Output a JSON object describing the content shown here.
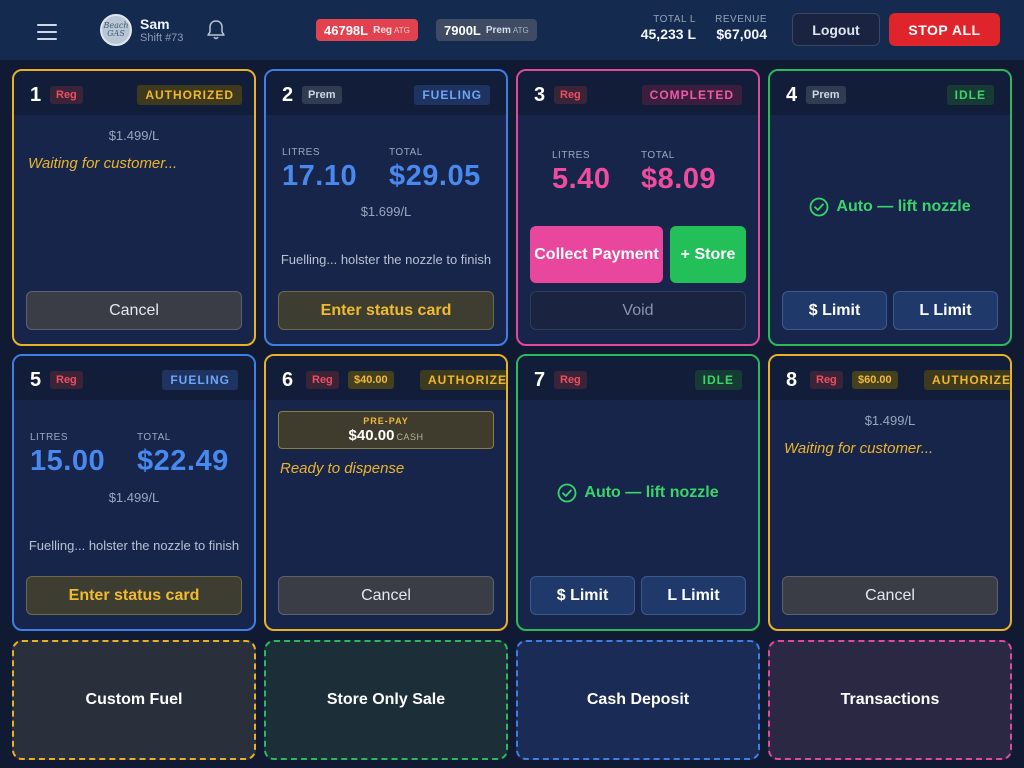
{
  "header": {
    "user": {
      "name": "Sam",
      "shift": "Shift #73",
      "avatar_text": "Beach\nGAS"
    },
    "tanks": [
      {
        "amount": "46798L",
        "grade": "Reg",
        "tag": "ATG",
        "color": "#e2424f"
      },
      {
        "amount": "7900L",
        "grade": "Prem",
        "tag": "ATG",
        "color": "#3e4b63"
      }
    ],
    "stats": {
      "total_l_label": "TOTAL L",
      "total_l_value": "45,233 L",
      "revenue_label": "REVENUE",
      "revenue_value": "$67,004"
    },
    "logout_label": "Logout",
    "stop_all_label": "STOP ALL"
  },
  "pumps": [
    {
      "number": "1",
      "grade": "Reg",
      "status": "AUTHORIZED",
      "price": "$1.499/L",
      "message": "Waiting for customer...",
      "action": "Cancel"
    },
    {
      "number": "2",
      "grade": "Prem",
      "status": "FUELING",
      "litres_label": "LITRES",
      "litres": "17.10",
      "total_label": "TOTAL",
      "total": "$29.05",
      "price": "$1.699/L",
      "message": "Fuelling... holster the nozzle to finish",
      "action": "Enter status card"
    },
    {
      "number": "3",
      "grade": "Reg",
      "status": "COMPLETED",
      "litres_label": "LITRES",
      "litres": "5.40",
      "total_label": "TOTAL",
      "total": "$8.09",
      "collect": "Collect Payment",
      "store": "+ Store",
      "void": "Void"
    },
    {
      "number": "4",
      "grade": "Prem",
      "status": "IDLE",
      "auto": "Auto — lift nozzle",
      "limit_dollar": "$ Limit",
      "limit_litre": "L Limit"
    },
    {
      "number": "5",
      "grade": "Reg",
      "status": "FUELING",
      "litres_label": "LITRES",
      "litres": "15.00",
      "total_label": "TOTAL",
      "total": "$22.49",
      "price": "$1.499/L",
      "message": "Fuelling... holster the nozzle to finish",
      "action": "Enter status card"
    },
    {
      "number": "6",
      "grade": "Reg",
      "prepay": "$40.00",
      "status": "AUTHORIZE",
      "prepay_label": "PRE-PAY",
      "prepay_amount": "$40.00",
      "prepay_method": "CASH",
      "message": "Ready to dispense",
      "action": "Cancel"
    },
    {
      "number": "7",
      "grade": "Reg",
      "status": "IDLE",
      "auto": "Auto — lift nozzle",
      "limit_dollar": "$ Limit",
      "limit_litre": "L Limit"
    },
    {
      "number": "8",
      "grade": "Reg",
      "prepay": "$60.00",
      "status": "AUTHORIZE",
      "price": "$1.499/L",
      "message": "Waiting for customer...",
      "action": "Cancel"
    }
  ],
  "actions": {
    "custom_fuel": "Custom Fuel",
    "store_only": "Store Only Sale",
    "cash_deposit": "Cash Deposit",
    "transactions": "Transactions"
  },
  "colors": {
    "authorized": "#e9b226",
    "fueling": "#3f7fe4",
    "completed": "#e2489e",
    "idle": "#2bb95a",
    "stop": "#e0242b"
  }
}
